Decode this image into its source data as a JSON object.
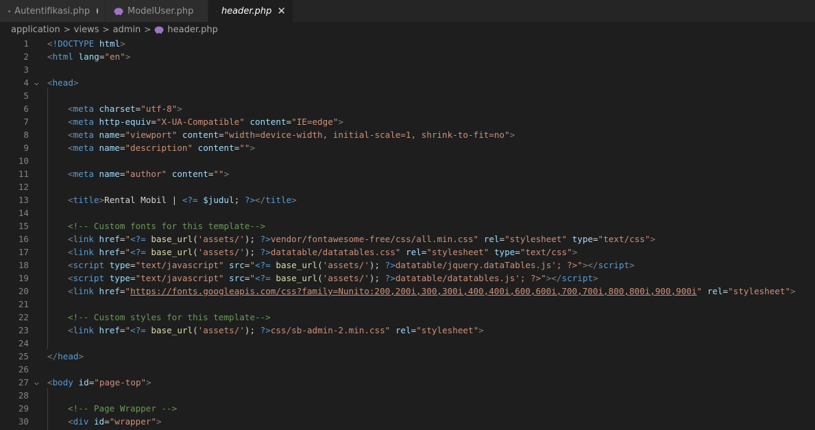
{
  "tabs": [
    {
      "label": "Autentifikasi.php",
      "modified": true,
      "active": false
    },
    {
      "label": "ModelUser.php",
      "modified": false,
      "active": false
    },
    {
      "label": "header.php",
      "modified": false,
      "active": true,
      "close": "✕"
    }
  ],
  "breadcrumb": {
    "parts": [
      "application",
      "views",
      "admin"
    ],
    "file": "header.php",
    "separator": ">"
  },
  "colors": {
    "tag": "#569cd6",
    "attribute": "#9cdcfe",
    "string": "#ce9178",
    "comment": "#6a9955",
    "function": "#dcdcaa",
    "background": "#1e1e1e"
  },
  "icons": {
    "php_file": "php-elephant-icon",
    "fold": "chevron-down-icon",
    "close": "close-icon"
  },
  "lines": [
    {
      "n": "1",
      "fold": false,
      "indent": 0,
      "tokens": [
        [
          "brk",
          "<"
        ],
        [
          "tag",
          "!DOCTYPE"
        ],
        [
          "txt",
          " "
        ],
        [
          "attr",
          "html"
        ],
        [
          "brk",
          ">"
        ]
      ]
    },
    {
      "n": "2",
      "fold": false,
      "indent": 0,
      "tokens": [
        [
          "brk",
          "<"
        ],
        [
          "tag",
          "html"
        ],
        [
          "txt",
          " "
        ],
        [
          "attr",
          "lang"
        ],
        [
          "txt",
          "="
        ],
        [
          "str",
          "\"en\""
        ],
        [
          "brk",
          ">"
        ]
      ]
    },
    {
      "n": "3",
      "fold": false,
      "indent": 0,
      "tokens": []
    },
    {
      "n": "4",
      "fold": true,
      "indent": 0,
      "tokens": [
        [
          "brk",
          "<"
        ],
        [
          "tag",
          "head"
        ],
        [
          "brk",
          ">"
        ]
      ]
    },
    {
      "n": "5",
      "fold": false,
      "indent": 1,
      "tokens": []
    },
    {
      "n": "6",
      "fold": false,
      "indent": 1,
      "tokens": [
        [
          "brk",
          "<"
        ],
        [
          "tag",
          "meta"
        ],
        [
          "txt",
          " "
        ],
        [
          "attr",
          "charset"
        ],
        [
          "txt",
          "="
        ],
        [
          "str",
          "\"utf-8\""
        ],
        [
          "brk",
          ">"
        ]
      ]
    },
    {
      "n": "7",
      "fold": false,
      "indent": 1,
      "tokens": [
        [
          "brk",
          "<"
        ],
        [
          "tag",
          "meta"
        ],
        [
          "txt",
          " "
        ],
        [
          "attr",
          "http-equiv"
        ],
        [
          "txt",
          "="
        ],
        [
          "str",
          "\"X-UA-Compatible\""
        ],
        [
          "txt",
          " "
        ],
        [
          "attr",
          "content"
        ],
        [
          "txt",
          "="
        ],
        [
          "str",
          "\"IE=edge\""
        ],
        [
          "brk",
          ">"
        ]
      ]
    },
    {
      "n": "8",
      "fold": false,
      "indent": 1,
      "tokens": [
        [
          "brk",
          "<"
        ],
        [
          "tag",
          "meta"
        ],
        [
          "txt",
          " "
        ],
        [
          "attr",
          "name"
        ],
        [
          "txt",
          "="
        ],
        [
          "str",
          "\"viewport\""
        ],
        [
          "txt",
          " "
        ],
        [
          "attr",
          "content"
        ],
        [
          "txt",
          "="
        ],
        [
          "str",
          "\"width=device-width, initial-scale=1, shrink-to-fit=no\""
        ],
        [
          "brk",
          ">"
        ]
      ]
    },
    {
      "n": "9",
      "fold": false,
      "indent": 1,
      "tokens": [
        [
          "brk",
          "<"
        ],
        [
          "tag",
          "meta"
        ],
        [
          "txt",
          " "
        ],
        [
          "attr",
          "name"
        ],
        [
          "txt",
          "="
        ],
        [
          "str",
          "\"description\""
        ],
        [
          "txt",
          " "
        ],
        [
          "attr",
          "content"
        ],
        [
          "txt",
          "="
        ],
        [
          "str",
          "\"\""
        ],
        [
          "brk",
          ">"
        ]
      ]
    },
    {
      "n": "10",
      "fold": false,
      "indent": 1,
      "tokens": []
    },
    {
      "n": "11",
      "fold": false,
      "indent": 1,
      "tokens": [
        [
          "brk",
          "<"
        ],
        [
          "tag",
          "meta"
        ],
        [
          "txt",
          " "
        ],
        [
          "attr",
          "name"
        ],
        [
          "txt",
          "="
        ],
        [
          "str",
          "\"author\""
        ],
        [
          "txt",
          " "
        ],
        [
          "attr",
          "content"
        ],
        [
          "txt",
          "="
        ],
        [
          "str",
          "\"\""
        ],
        [
          "brk",
          ">"
        ]
      ]
    },
    {
      "n": "12",
      "fold": false,
      "indent": 1,
      "tokens": []
    },
    {
      "n": "13",
      "fold": false,
      "indent": 1,
      "tokens": [
        [
          "brk",
          "<"
        ],
        [
          "tag",
          "title"
        ],
        [
          "brk",
          ">"
        ],
        [
          "txt",
          "Rental Mobil | "
        ],
        [
          "php",
          "<?="
        ],
        [
          "txt",
          " "
        ],
        [
          "var",
          "$judul"
        ],
        [
          "txt",
          "; "
        ],
        [
          "php",
          "?>"
        ],
        [
          "brk",
          "</"
        ],
        [
          "tag",
          "title"
        ],
        [
          "brk",
          ">"
        ]
      ]
    },
    {
      "n": "14",
      "fold": false,
      "indent": 1,
      "tokens": []
    },
    {
      "n": "15",
      "fold": false,
      "indent": 1,
      "tokens": [
        [
          "cmt",
          "<!-- Custom fonts for this template-->"
        ]
      ]
    },
    {
      "n": "16",
      "fold": false,
      "indent": 1,
      "tokens": [
        [
          "brk",
          "<"
        ],
        [
          "tag",
          "link"
        ],
        [
          "txt",
          " "
        ],
        [
          "attr",
          "href"
        ],
        [
          "txt",
          "="
        ],
        [
          "str",
          "\""
        ],
        [
          "php",
          "<?="
        ],
        [
          "txt",
          " "
        ],
        [
          "fn",
          "base_url"
        ],
        [
          "txt",
          "("
        ],
        [
          "str",
          "'assets/'"
        ],
        [
          "txt",
          "); "
        ],
        [
          "php",
          "?>"
        ],
        [
          "str",
          "vendor/fontawesome-free/css/all.min.css\""
        ],
        [
          "txt",
          " "
        ],
        [
          "attr",
          "rel"
        ],
        [
          "txt",
          "="
        ],
        [
          "str",
          "\"stylesheet\""
        ],
        [
          "txt",
          " "
        ],
        [
          "attr",
          "type"
        ],
        [
          "txt",
          "="
        ],
        [
          "str",
          "\"text/css\""
        ],
        [
          "brk",
          ">"
        ]
      ]
    },
    {
      "n": "17",
      "fold": false,
      "indent": 1,
      "tokens": [
        [
          "brk",
          "<"
        ],
        [
          "tag",
          "link"
        ],
        [
          "txt",
          " "
        ],
        [
          "attr",
          "href"
        ],
        [
          "txt",
          "="
        ],
        [
          "str",
          "\""
        ],
        [
          "php",
          "<?="
        ],
        [
          "txt",
          " "
        ],
        [
          "fn",
          "base_url"
        ],
        [
          "txt",
          "("
        ],
        [
          "str",
          "'assets/'"
        ],
        [
          "txt",
          "); "
        ],
        [
          "php",
          "?>"
        ],
        [
          "str",
          "datatable/datatables.css\""
        ],
        [
          "txt",
          " "
        ],
        [
          "attr",
          "rel"
        ],
        [
          "txt",
          "="
        ],
        [
          "str",
          "\"stylesheet\""
        ],
        [
          "txt",
          " "
        ],
        [
          "attr",
          "type"
        ],
        [
          "txt",
          "="
        ],
        [
          "str",
          "\"text/css\""
        ],
        [
          "brk",
          ">"
        ]
      ]
    },
    {
      "n": "18",
      "fold": false,
      "indent": 1,
      "tokens": [
        [
          "brk",
          "<"
        ],
        [
          "tag",
          "script"
        ],
        [
          "txt",
          " "
        ],
        [
          "attr",
          "type"
        ],
        [
          "txt",
          "="
        ],
        [
          "str",
          "\"text/javascript\""
        ],
        [
          "txt",
          " "
        ],
        [
          "attr",
          "src"
        ],
        [
          "txt",
          "="
        ],
        [
          "str",
          "\""
        ],
        [
          "php",
          "<?="
        ],
        [
          "txt",
          " "
        ],
        [
          "fn",
          "base_url"
        ],
        [
          "txt",
          "("
        ],
        [
          "str",
          "'assets/'"
        ],
        [
          "txt",
          "); "
        ],
        [
          "php",
          "?>"
        ],
        [
          "str",
          "datatable/jquery.dataTables.js'; ?>\""
        ],
        [
          "brk",
          "></"
        ],
        [
          "tag",
          "script"
        ],
        [
          "brk",
          ">"
        ]
      ]
    },
    {
      "n": "19",
      "fold": false,
      "indent": 1,
      "tokens": [
        [
          "brk",
          "<"
        ],
        [
          "tag",
          "script"
        ],
        [
          "txt",
          " "
        ],
        [
          "attr",
          "type"
        ],
        [
          "txt",
          "="
        ],
        [
          "str",
          "\"text/javascript\""
        ],
        [
          "txt",
          " "
        ],
        [
          "attr",
          "src"
        ],
        [
          "txt",
          "="
        ],
        [
          "str",
          "\""
        ],
        [
          "php",
          "<?="
        ],
        [
          "txt",
          " "
        ],
        [
          "fn",
          "base_url"
        ],
        [
          "txt",
          "("
        ],
        [
          "str",
          "'assets/'"
        ],
        [
          "txt",
          "); "
        ],
        [
          "php",
          "?>"
        ],
        [
          "str",
          "datatable/datatables.js'; ?>\""
        ],
        [
          "brk",
          "></"
        ],
        [
          "tag",
          "script"
        ],
        [
          "brk",
          ">"
        ]
      ]
    },
    {
      "n": "20",
      "fold": false,
      "indent": 1,
      "tokens": [
        [
          "brk",
          "<"
        ],
        [
          "tag",
          "link"
        ],
        [
          "txt",
          " "
        ],
        [
          "attr",
          "href"
        ],
        [
          "txt",
          "="
        ],
        [
          "str",
          "\""
        ],
        [
          "url",
          "https://fonts.googleapis.com/css?family=Nunito:200,200i,300,300i,400,400i,600,600i,700,700i,800,800i,900,900i"
        ],
        [
          "str",
          "\""
        ],
        [
          "txt",
          " "
        ],
        [
          "attr",
          "rel"
        ],
        [
          "txt",
          "="
        ],
        [
          "str",
          "\"stylesheet\""
        ],
        [
          "brk",
          ">"
        ]
      ]
    },
    {
      "n": "21",
      "fold": false,
      "indent": 1,
      "tokens": []
    },
    {
      "n": "22",
      "fold": false,
      "indent": 1,
      "tokens": [
        [
          "cmt",
          "<!-- Custom styles for this template-->"
        ]
      ]
    },
    {
      "n": "23",
      "fold": false,
      "indent": 1,
      "tokens": [
        [
          "brk",
          "<"
        ],
        [
          "tag",
          "link"
        ],
        [
          "txt",
          " "
        ],
        [
          "attr",
          "href"
        ],
        [
          "txt",
          "="
        ],
        [
          "str",
          "\""
        ],
        [
          "php",
          "<?="
        ],
        [
          "txt",
          " "
        ],
        [
          "fn",
          "base_url"
        ],
        [
          "txt",
          "("
        ],
        [
          "str",
          "'assets/'"
        ],
        [
          "txt",
          "); "
        ],
        [
          "php",
          "?>"
        ],
        [
          "str",
          "css/sb-admin-2.min.css\""
        ],
        [
          "txt",
          " "
        ],
        [
          "attr",
          "rel"
        ],
        [
          "txt",
          "="
        ],
        [
          "str",
          "\"stylesheet\""
        ],
        [
          "brk",
          ">"
        ]
      ]
    },
    {
      "n": "24",
      "fold": false,
      "indent": 1,
      "tokens": []
    },
    {
      "n": "25",
      "fold": false,
      "indent": 0,
      "tokens": [
        [
          "brk",
          "</"
        ],
        [
          "tag",
          "head"
        ],
        [
          "brk",
          ">"
        ]
      ]
    },
    {
      "n": "26",
      "fold": false,
      "indent": 0,
      "tokens": []
    },
    {
      "n": "27",
      "fold": true,
      "indent": 0,
      "tokens": [
        [
          "brk",
          "<"
        ],
        [
          "tag",
          "body"
        ],
        [
          "txt",
          " "
        ],
        [
          "attr",
          "id"
        ],
        [
          "txt",
          "="
        ],
        [
          "str",
          "\"page-top\""
        ],
        [
          "brk",
          ">"
        ]
      ]
    },
    {
      "n": "28",
      "fold": false,
      "indent": 1,
      "tokens": []
    },
    {
      "n": "29",
      "fold": false,
      "indent": 1,
      "tokens": [
        [
          "cmt",
          "<!-- Page Wrapper -->"
        ]
      ]
    },
    {
      "n": "30",
      "fold": false,
      "indent": 1,
      "tokens": [
        [
          "brk",
          "<"
        ],
        [
          "tag",
          "div"
        ],
        [
          "txt",
          " "
        ],
        [
          "attr",
          "id"
        ],
        [
          "txt",
          "="
        ],
        [
          "str",
          "\"wrapper\""
        ],
        [
          "brk",
          ">"
        ]
      ]
    }
  ]
}
